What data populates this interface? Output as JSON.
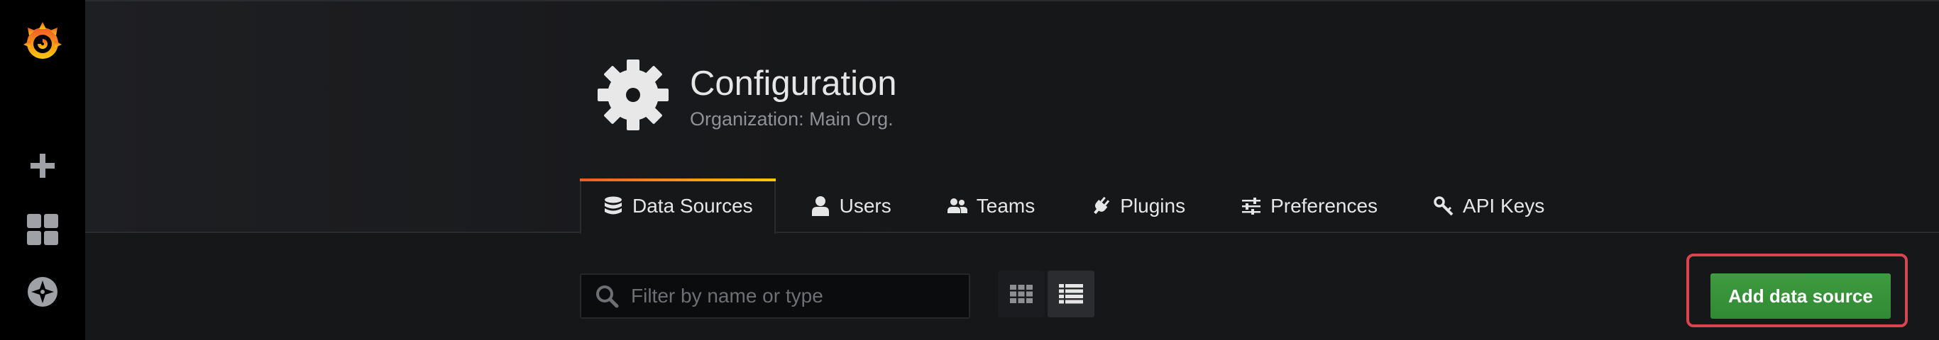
{
  "page": {
    "title": "Configuration",
    "subtitle": "Organization: Main Org."
  },
  "sidemenu": {
    "items": [
      {
        "name": "grafana-logo",
        "icon": "grafana-logo-icon"
      },
      {
        "name": "create",
        "icon": "plus-icon"
      },
      {
        "name": "dashboards",
        "icon": "dashboard-grid-icon"
      },
      {
        "name": "explore",
        "icon": "compass-icon"
      }
    ]
  },
  "tabs": [
    {
      "label": "Data Sources",
      "icon": "database-icon",
      "active": true
    },
    {
      "label": "Users",
      "icon": "user-icon",
      "active": false
    },
    {
      "label": "Teams",
      "icon": "users-icon",
      "active": false
    },
    {
      "label": "Plugins",
      "icon": "plug-icon",
      "active": false
    },
    {
      "label": "Preferences",
      "icon": "sliders-icon",
      "active": false
    },
    {
      "label": "API Keys",
      "icon": "key-icon",
      "active": false
    }
  ],
  "toolbar": {
    "search": {
      "placeholder": "Filter by name or type",
      "value": ""
    },
    "layout_modes": [
      "grid",
      "list"
    ],
    "active_layout": "list",
    "add_button_label": "Add data source"
  },
  "colors": {
    "accent_gradient_start": "#f05a28",
    "accent_gradient_end": "#fbca0a",
    "primary_button": "#3f9b3f",
    "highlight_outline": "#d9454f"
  }
}
